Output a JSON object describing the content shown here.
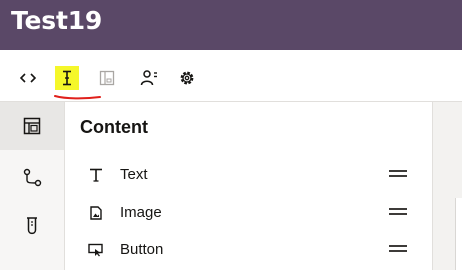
{
  "app": {
    "title": "Test19"
  },
  "toolbar": {
    "items": [
      {
        "icon": "code-icon"
      },
      {
        "icon": "text-cursor-icon",
        "highlighted": true
      },
      {
        "icon": "preview-frame-icon",
        "disabled": true
      },
      {
        "icon": "user-settings-icon"
      },
      {
        "icon": "gear-icon"
      }
    ],
    "highlight_color": "#f5f72a",
    "annotation_color": "#e0201b"
  },
  "rail": {
    "items": [
      {
        "icon": "layout-icon",
        "active": true
      },
      {
        "icon": "flow-icon"
      },
      {
        "icon": "test-tube-icon"
      }
    ]
  },
  "panel": {
    "title": "Content",
    "items": [
      {
        "label": "Text",
        "icon": "text-icon"
      },
      {
        "label": "Image",
        "icon": "image-icon"
      },
      {
        "label": "Button",
        "icon": "button-cursor-icon"
      }
    ]
  },
  "colors": {
    "header": "#5a4867",
    "rail": "#f7f6f5",
    "text": "#161513"
  }
}
